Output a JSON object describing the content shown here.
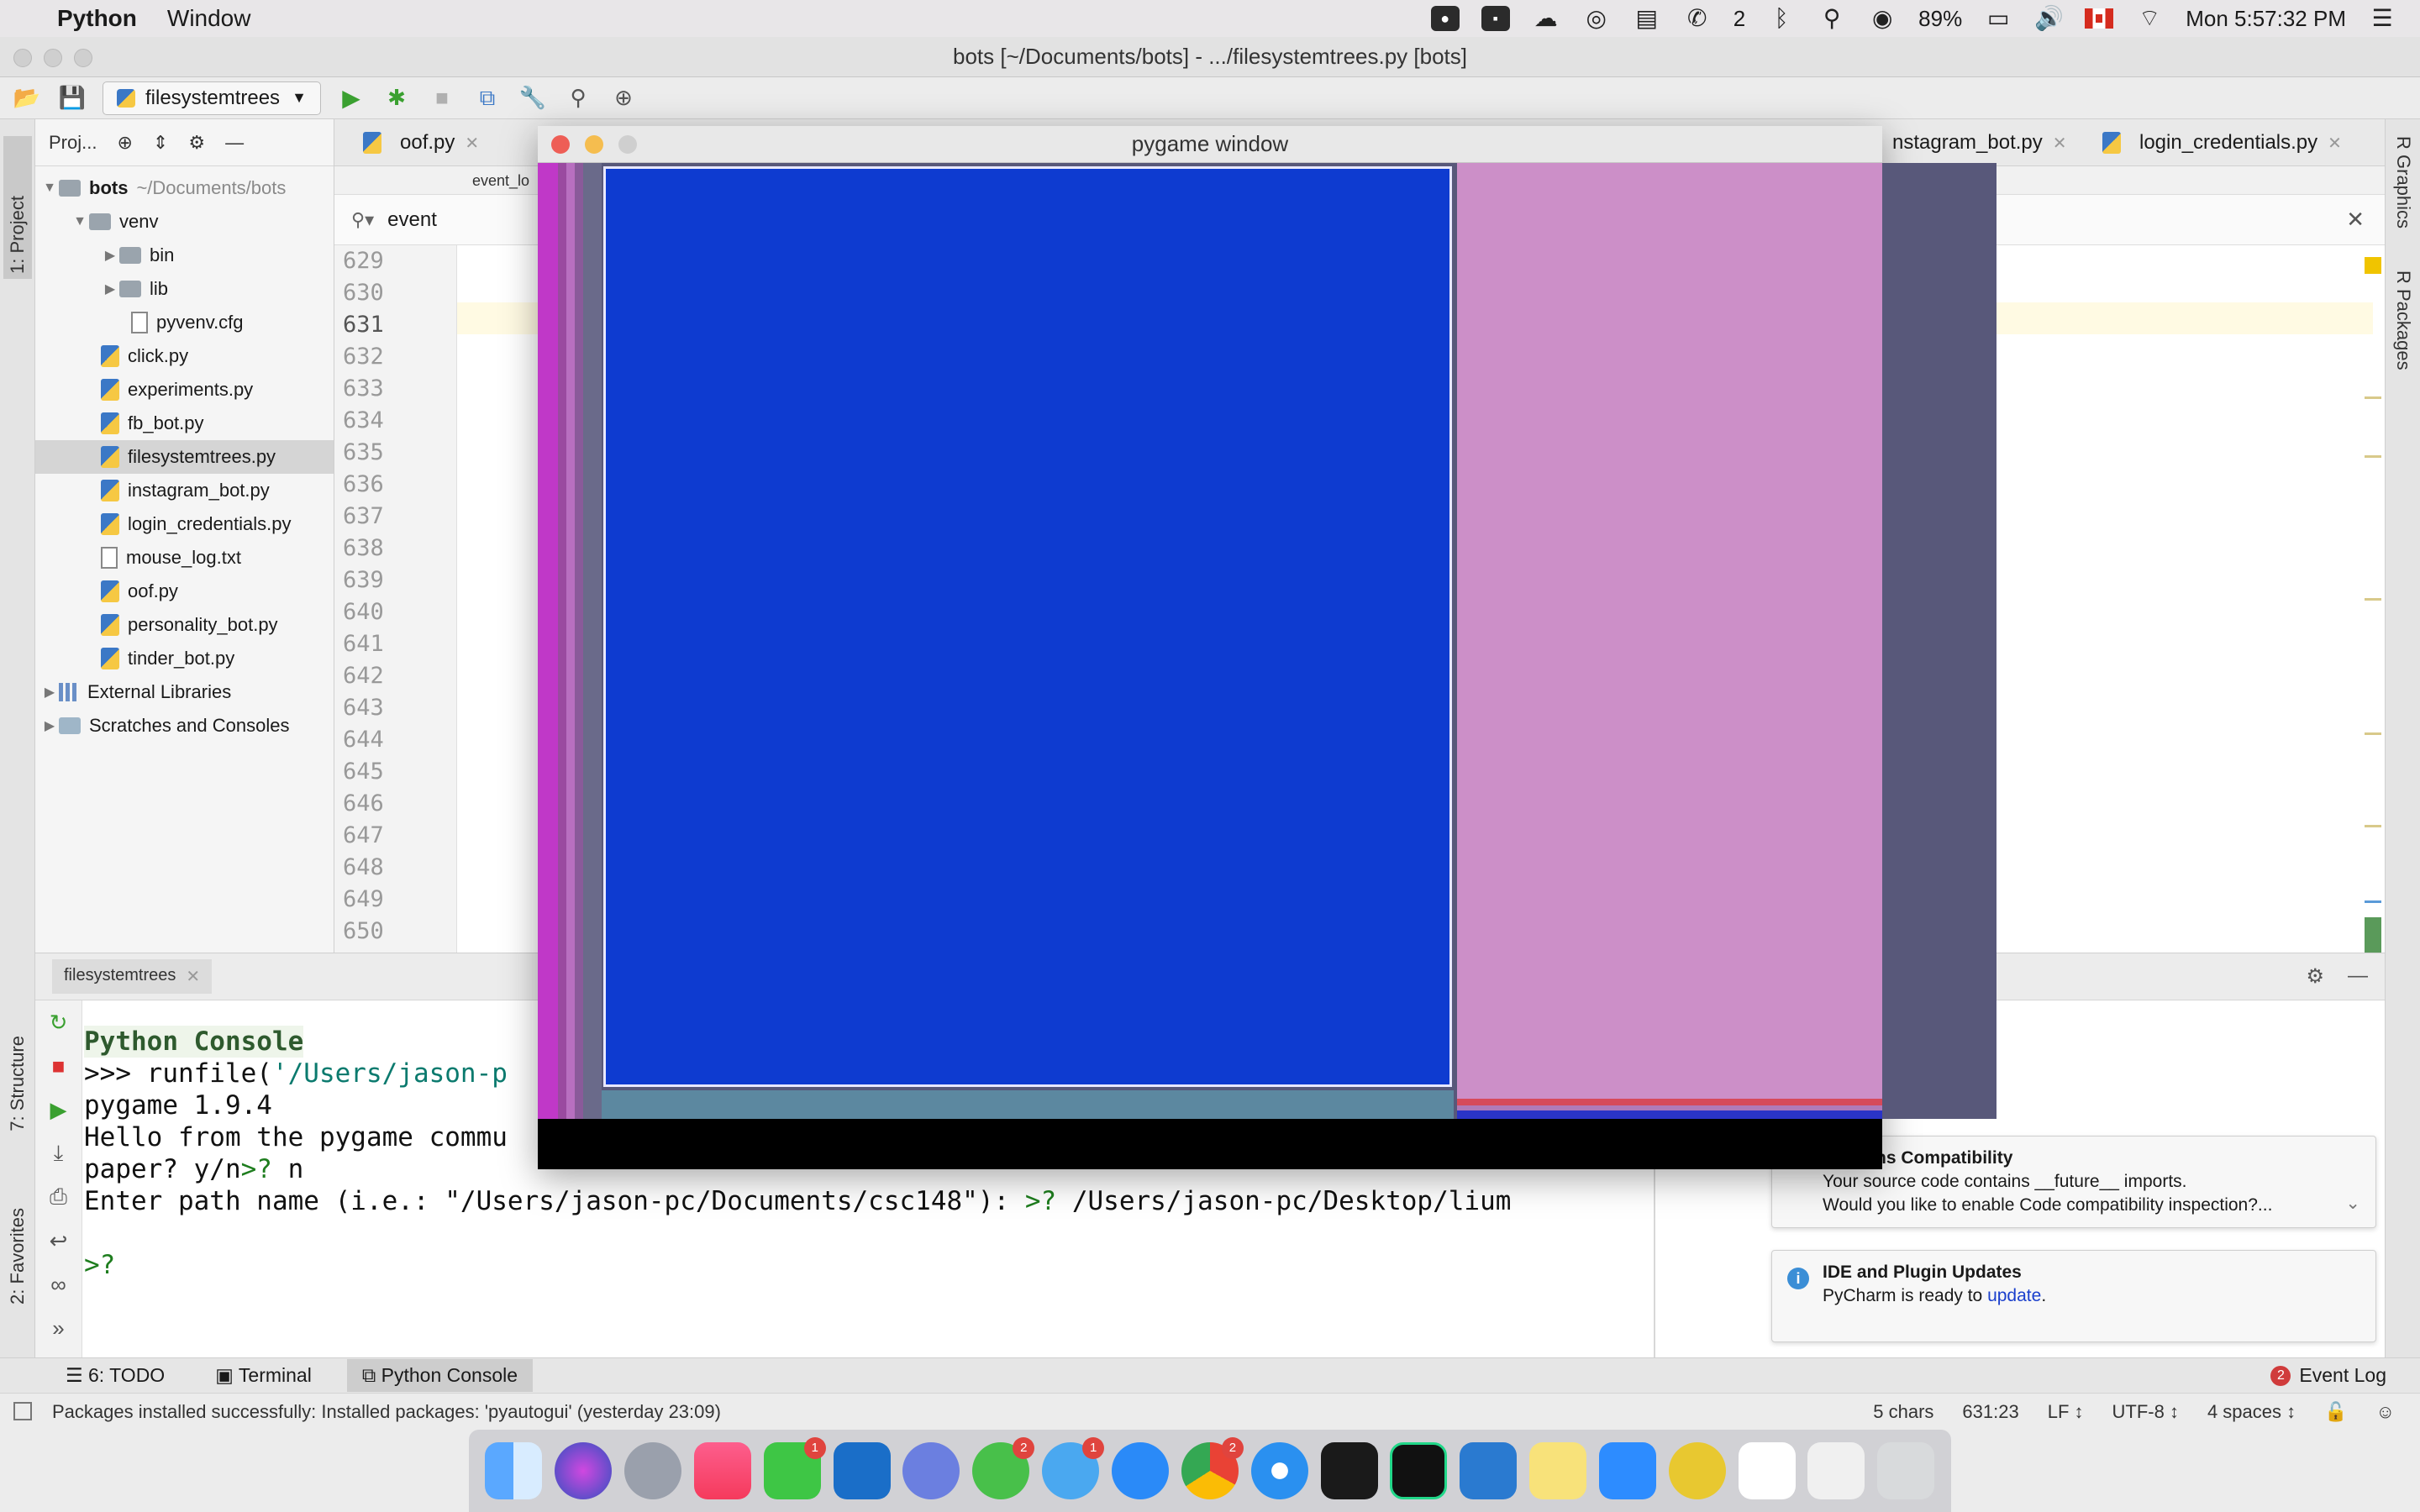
{
  "menubar": {
    "app_name": "Python",
    "menu_window": "Window",
    "wechat_count": "2",
    "battery": "89%",
    "clock": "Mon 5:57:32 PM"
  },
  "window": {
    "title": "bots [~/Documents/bots] - .../filesystemtrees.py [bots]"
  },
  "toolbar": {
    "run_config": "filesystemtrees"
  },
  "left_tools": {
    "project": "1: Project",
    "structure": "7: Structure",
    "favorites": "2: Favorites"
  },
  "right_tools": {
    "graphics": "R Graphics",
    "packages": "R Packages"
  },
  "project_panel": {
    "header": "Proj...",
    "root_name": "bots",
    "root_path": "~/Documents/bots",
    "venv": "venv",
    "bin": "bin",
    "lib": "lib",
    "cfg": "pyvenv.cfg",
    "files": [
      "click.py",
      "experiments.py",
      "fb_bot.py",
      "filesystemtrees.py",
      "instagram_bot.py",
      "login_credentials.py",
      "mouse_log.txt",
      "oof.py",
      "personality_bot.py",
      "tinder_bot.py"
    ],
    "external": "External Libraries",
    "scratches": "Scratches and Consoles"
  },
  "editor": {
    "tabs": [
      "oof.py",
      "nstagram_bot.py",
      "login_credentials.py"
    ],
    "subtab": "event_lo",
    "search_value": "event",
    "line_numbers": [
      "629",
      "630",
      "631",
      "632",
      "633",
      "634",
      "635",
      "636",
      "637",
      "638",
      "639",
      "640",
      "641",
      "642",
      "643",
      "644",
      "645",
      "646",
      "647",
      "648",
      "649",
      "650"
    ]
  },
  "bottom_panel": {
    "tab": "filesystemtrees",
    "console_lines": {
      "title": "Python Console",
      "l1_prompt": ">>> ",
      "l1_cmd": "runfile(",
      "l1_str": "'/Users/jason-p",
      "l2": "pygame 1.9.4",
      "l3": "Hello from the pygame commu",
      "l4a": "paper? y/n",
      "l4b": ">? ",
      "l4c": "n",
      "l5a": "Enter path name (i.e.: \"/Users/jason-pc/Documents/csc148\"): ",
      "l5b": ">? ",
      "l5c": "/Users/jason-pc/Desktop/lium",
      "l6": ">?"
    }
  },
  "notifications": {
    "compat_title": "Versions Compatibility",
    "compat_l1": "Your source code contains __future__ imports.",
    "compat_l2": "Would you like to enable Code compatibility inspection?...",
    "upd_title": "IDE and Plugin Updates",
    "upd_text": "PyCharm is ready to ",
    "upd_link": "update",
    "upd_end": "."
  },
  "tool_tabs": {
    "todo": "6: TODO",
    "terminal": "Terminal",
    "console": "Python Console",
    "event_log": "Event Log",
    "event_count": "2"
  },
  "statusbar": {
    "message": "Packages installed successfully: Installed packages: 'pyautogui' (yesterday 23:09)",
    "chars": "5 chars",
    "pos": "631:23",
    "lf": "LF ↕",
    "enc": "UTF-8 ↕",
    "indent": "4 spaces ↕"
  },
  "pygame": {
    "title": "pygame window"
  },
  "dock": {
    "facetime_badge": "1",
    "wechat_badge": "2",
    "messages_badge": "1",
    "chrome_badge": "2"
  },
  "colors": {
    "pg_blue": "#0e3bd0",
    "pg_pink": "#cc8fc8",
    "pg_magenta": "#c038c8",
    "pg_steel": "#5c88a0"
  }
}
